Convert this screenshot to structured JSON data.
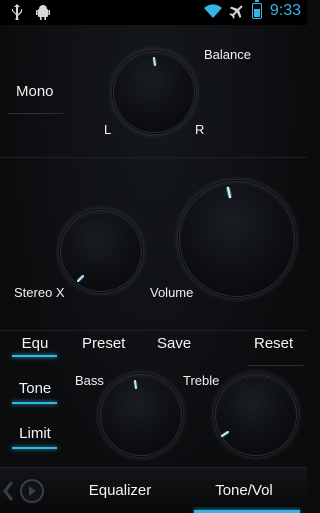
{
  "statusbar": {
    "time": "9:33",
    "icons": [
      "usb-icon",
      "android-debug-icon",
      "wifi-icon",
      "airplane-mode-icon",
      "battery-icon"
    ],
    "accent": "#33b5e5"
  },
  "balance": {
    "title": "Balance",
    "left_label": "L",
    "right_label": "R",
    "mode_label": "Mono"
  },
  "stereo": {
    "stereo_x_label": "Stereo X",
    "volume_label": "Volume"
  },
  "tone_panel": {
    "side_buttons": [
      "Equ",
      "Tone",
      "Limit"
    ],
    "toolbar": {
      "preset": "Preset",
      "save": "Save",
      "reset": "Reset"
    },
    "bass_label": "Bass",
    "treble_label": "Treble"
  },
  "bottom_tabs": {
    "tabs": [
      "Equalizer",
      "Tone/Vol"
    ],
    "active": "Tone/Vol"
  },
  "colors": {
    "accent": "#33b5e5",
    "background": "#0b0c0e",
    "text": "#ffffff"
  }
}
